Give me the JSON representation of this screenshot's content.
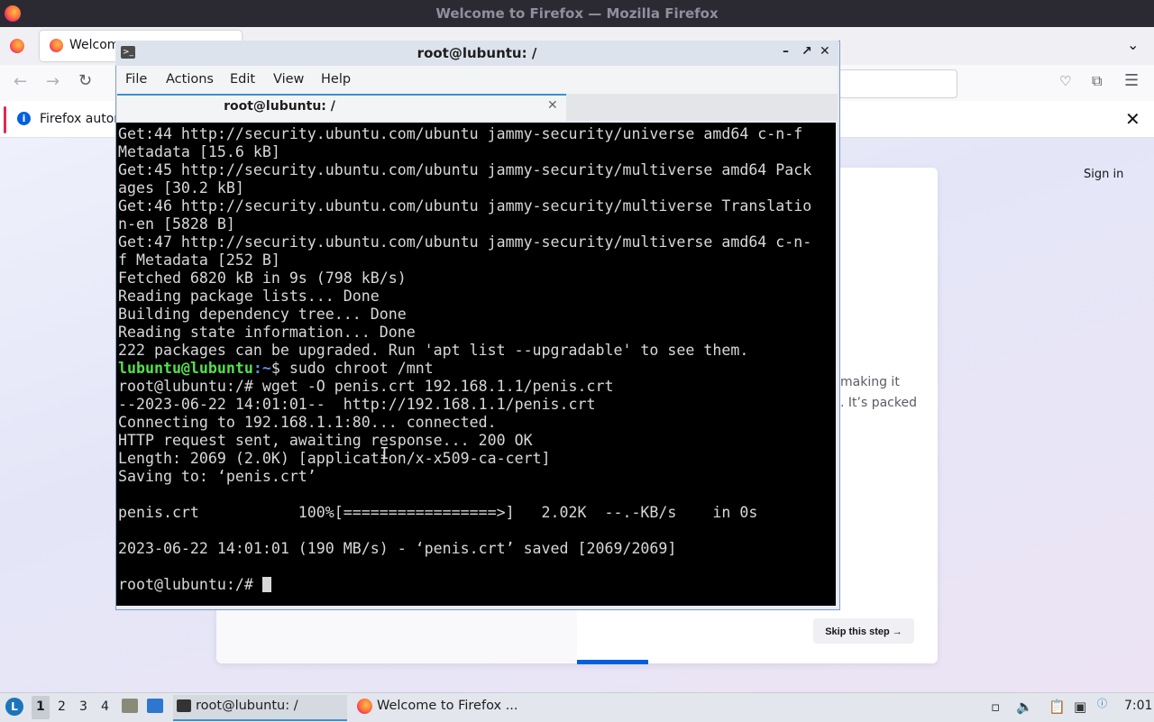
{
  "firefox": {
    "window_title": "Welcome to Firefox — Mozilla Firefox",
    "tab_label": "Welcom",
    "notification_text": "Firefox autor",
    "sign_in": "Sign in",
    "card_text_1": "making it",
    "card_text_2": ". It’s packed",
    "skip_button": "Skip this step →"
  },
  "terminal": {
    "title": "root@lubuntu: /",
    "menu": [
      "File",
      "Actions",
      "Edit",
      "View",
      "Help"
    ],
    "tab_label": "root@lubuntu: /",
    "lines_before": [
      "Get:44 http://security.ubuntu.com/ubuntu jammy-security/universe amd64 c-n-f",
      "Metadata [15.6 kB]",
      "Get:45 http://security.ubuntu.com/ubuntu jammy-security/multiverse amd64 Pack",
      "ages [30.2 kB]",
      "Get:46 http://security.ubuntu.com/ubuntu jammy-security/multiverse Translatio",
      "n-en [5828 B]",
      "Get:47 http://security.ubuntu.com/ubuntu jammy-security/multiverse amd64 c-n-",
      "f Metadata [252 B]",
      "Fetched 6820 kB in 9s (798 kB/s)",
      "Reading package lists... Done",
      "Building dependency tree... Done",
      "Reading state information... Done",
      "222 packages can be upgraded. Run 'apt list --upgradable' to see them."
    ],
    "prompt_user": "lubuntu@lubuntu",
    "prompt_path": ":~",
    "prompt_cmd": "$ sudo chroot /mnt",
    "lines_after": [
      "root@lubuntu:/# wget -O penis.crt 192.168.1.1/penis.crt",
      "--2023-06-22 14:01:01--  http://192.168.1.1/penis.crt",
      "Connecting to 192.168.1.1:80... connected.",
      "HTTP request sent, awaiting response... 200 OK",
      "Length: 2069 (2.0K) [application/x-x509-ca-cert]",
      "Saving to: ‘penis.crt’",
      "",
      "penis.crt           100%[=================>]   2.02K  --.-KB/s    in 0s",
      "",
      "2023-06-22 14:01:01 (190 MB/s) - ‘penis.crt’ saved [2069/2069]",
      ""
    ],
    "final_prompt": "root@lubuntu:/# "
  },
  "taskbar": {
    "workspaces": [
      "1",
      "2",
      "3",
      "4"
    ],
    "task_terminal": "root@lubuntu: /",
    "task_firefox": "Welcome to Firefox ...",
    "clock": "7:01"
  }
}
